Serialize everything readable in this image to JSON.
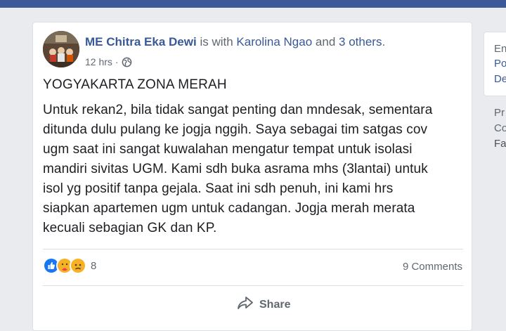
{
  "post": {
    "author": "ME Chitra Eka Dewi",
    "with_text": "is with",
    "tagged": "Karolina Ngao",
    "and_text": "and",
    "others": "3 others",
    "period": ".",
    "time": "12 hrs",
    "sep": "·",
    "privacy_icon": "globe-icon",
    "title": "YOGYAKARTA ZONA MERAH",
    "body_lines": [
      "Untuk rekan2, bila tidak sangat penting dan mndesak, sementara",
      "ditunda dulu pulang ke jogja nggih. Saya sebagai tim satgas cov",
      "ugm saat ini sangat kuwalahan mengatur tempat untuk isolasi",
      "mandiri sivitas UGM. Kami sdh buka asrama mhs (3lantai) untuk",
      "isol yg positif tanpa gejala. Saat ini sdh penuh, ini kami hrs",
      "siapkan apartemen ugm untuk cadangan. Jogja merah merata",
      "kecuali sebagian GK dan KP."
    ],
    "reaction_icons": [
      "like-icon",
      "care-icon",
      "sad-icon"
    ],
    "reaction_count": "8",
    "comments": "9 Comments",
    "share_label": "Share"
  },
  "right_column": {
    "box_lines": [
      "En",
      "Po",
      "De"
    ],
    "lines": [
      "Pr",
      "Co",
      "Fa"
    ]
  },
  "colors": {
    "topbar": "#3b5998",
    "link": "#385898",
    "muted": "#616770"
  }
}
